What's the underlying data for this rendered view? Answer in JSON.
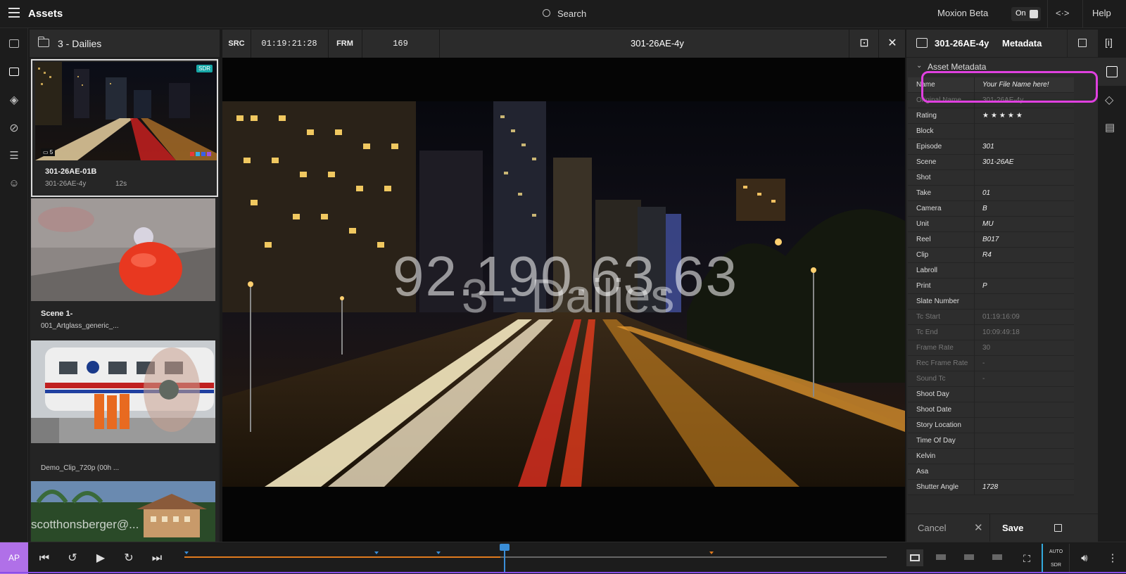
{
  "app": {
    "title": "Assets",
    "search_label": "Search",
    "beta_label": "Moxion Beta",
    "toggle_label": "On",
    "code_label": "<·>",
    "help_label": "Help"
  },
  "assets_panel": {
    "folder_name": "3 - Dailies",
    "items": [
      {
        "title": "301-26AE-01B",
        "subtitle": "301-26AE-4y",
        "duration": "12s",
        "badge": "SDR",
        "comments": "5"
      },
      {
        "title": "Scene 1-",
        "subtitle": "001_Artglass_generic_..."
      },
      {
        "title": "",
        "subtitle": "Demo_Clip_720p (00h ..."
      },
      {
        "title": "",
        "subtitle": "scotthonsberger@..."
      }
    ]
  },
  "viewer": {
    "src_label": "SRC",
    "src_timecode": "01:19:21:28",
    "frm_label": "FRM",
    "frame": "169",
    "clip_name": "301-26AE-4y",
    "watermark_ip": "92.190.63.63",
    "watermark_label": "3 - Dailies"
  },
  "metadata": {
    "asset_name": "301-26AE-4y",
    "tab_label": "Metadata",
    "section_label": "Asset Metadata",
    "rows": [
      {
        "key": "Name",
        "value": "Your File Name here!"
      },
      {
        "key": "Original Name",
        "value": "301-26AE-4y"
      },
      {
        "key": "Rating",
        "value": "★★★★★"
      },
      {
        "key": "Block",
        "value": ""
      },
      {
        "key": "Episode",
        "value": "301"
      },
      {
        "key": "Scene",
        "value": "301-26AE"
      },
      {
        "key": "Shot",
        "value": ""
      },
      {
        "key": "Take",
        "value": "01"
      },
      {
        "key": "Camera",
        "value": "B"
      },
      {
        "key": "Unit",
        "value": "MU"
      },
      {
        "key": "Reel",
        "value": "B017"
      },
      {
        "key": "Clip",
        "value": "R4"
      },
      {
        "key": "Labroll",
        "value": ""
      },
      {
        "key": "Print",
        "value": "P"
      },
      {
        "key": "Slate Number",
        "value": ""
      },
      {
        "key": "Tc Start",
        "value": "01:19:16:09"
      },
      {
        "key": "Tc End",
        "value": "10:09:49:18"
      },
      {
        "key": "Frame Rate",
        "value": "30"
      },
      {
        "key": "Rec Frame Rate",
        "value": "-"
      },
      {
        "key": "Sound Tc",
        "value": "-"
      },
      {
        "key": "Shoot Day",
        "value": ""
      },
      {
        "key": "Shoot Date",
        "value": ""
      },
      {
        "key": "Story Location",
        "value": ""
      },
      {
        "key": "Time Of Day",
        "value": ""
      },
      {
        "key": "Kelvin",
        "value": ""
      },
      {
        "key": "Asa",
        "value": ""
      },
      {
        "key": "Shutter Angle",
        "value": "1728"
      }
    ],
    "cancel_label": "Cancel",
    "save_label": "Save"
  },
  "player": {
    "avatar_initials": "AP",
    "auto_label": "AUTO",
    "sdr_label": "SDR",
    "progress": 0.45
  },
  "colors": {
    "accent": "#3a8ed8",
    "progress": "#e07a1e",
    "highlight": "#e040e0",
    "avatar": "#b070e8",
    "sdr_badge": "#17a8a8"
  }
}
